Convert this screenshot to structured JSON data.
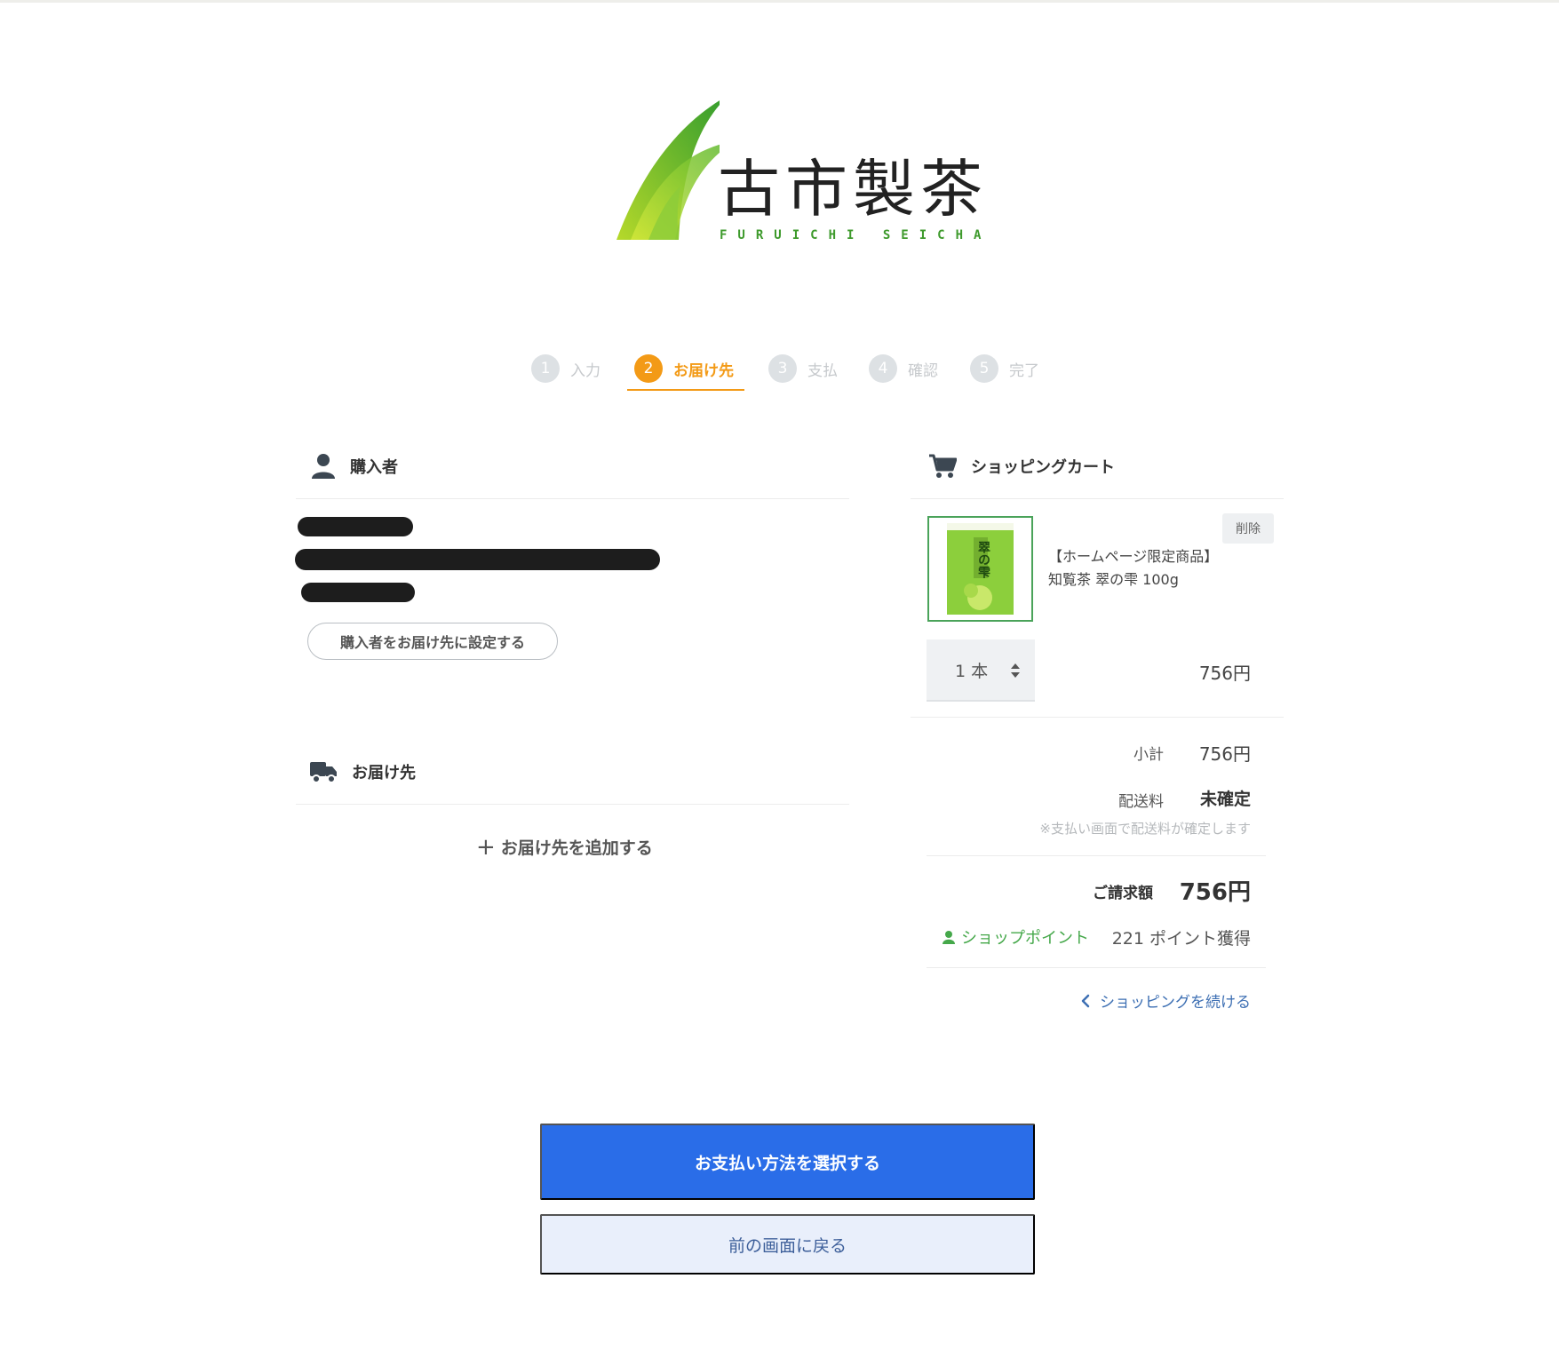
{
  "brand": {
    "name_kanji": "古市製茶",
    "name_roman": "FURUICHI SEICHA"
  },
  "steps": [
    {
      "num": "1",
      "label": "入力",
      "state": "inactive"
    },
    {
      "num": "2",
      "label": "お届け先",
      "state": "active"
    },
    {
      "num": "3",
      "label": "支払",
      "state": "inactive"
    },
    {
      "num": "4",
      "label": "確認",
      "state": "inactive"
    },
    {
      "num": "5",
      "label": "完了",
      "state": "inactive"
    }
  ],
  "purchaser": {
    "title": "購入者",
    "set_as_delivery_button": "購入者をお届け先に設定する"
  },
  "delivery": {
    "title": "お届け先",
    "add_link": "お届け先を追加する"
  },
  "cart": {
    "title": "ショッピングカート",
    "item": {
      "delete_label": "削除",
      "name": "【ホームページ限定商品】 知覧茶 翠の雫 100g",
      "quantity": "1 本",
      "price": "756円",
      "image_text": "翠の雫"
    },
    "subtotal_label": "小計",
    "subtotal_value": "756円",
    "shipping_label": "配送料",
    "shipping_value": "未確定",
    "shipping_note": "※支払い画面で配送料が確定します",
    "total_label": "ご請求額",
    "total_value": "756円",
    "points_label": "ショップポイント",
    "points_value": "221 ポイント獲得",
    "continue_link": "ショッピングを続ける"
  },
  "actions": {
    "primary": "お支払い方法を選択する",
    "secondary": "前の画面に戻る"
  },
  "colors": {
    "accent_orange": "#f39a16",
    "primary_blue": "#2a6de8",
    "brand_green": "#3e9a2c",
    "points_green": "#45a84a",
    "link_blue": "#3d6fb3"
  }
}
